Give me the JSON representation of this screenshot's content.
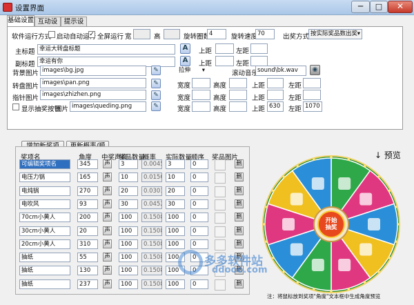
{
  "window": {
    "title": "设置界面",
    "min": "─",
    "max": "□",
    "close": "✕"
  },
  "tabs": [
    "基础设置",
    "互动设置",
    "提示设置"
  ],
  "basic": {
    "run_mode_label": "软件运行方式",
    "autostart_label": "启动自动运行",
    "autostart_checked": false,
    "fullscreen_label": "全屏运行",
    "fullscreen_checked": true,
    "width_label": "宽",
    "height_label": "高",
    "width_value": "",
    "height_value": "",
    "rotation_laps_label": "旋转圈数",
    "rotation_laps_value": "4",
    "rotation_speed_label": "旋转速度",
    "rotation_speed_value": "70",
    "award_mode_label": "出奖方式",
    "award_mode_value": "按实际奖品数出奖",
    "main_title_label": "主标题",
    "main_title_value": "幸运大转盘标题",
    "sub_title_label": "副标题",
    "sub_title_value": "幸运有你",
    "top_label": "上距",
    "left_label": "左距",
    "bg_image_label": "背景图片",
    "bg_image_value": "images\\bg.jpg",
    "stretch_value": "拉伸",
    "music_label": "滚动音乐",
    "music_value": "sound\\bk.wav",
    "wheel_image_label": "转盘图片",
    "wheel_image_value": "images\\pan.png",
    "pointer_image_label": "指针图片",
    "pointer_image_value": "images\\zhizhen.png",
    "show_draw_button_label": "显示抽奖按钮",
    "show_draw_button_checked": false,
    "image_label": "图片",
    "draw_button_image_value": "images\\queding.png",
    "width_short": "宽度",
    "height_short": "高度",
    "draw_button_top_value": "630",
    "draw_button_left_value": "1070"
  },
  "prizes": {
    "add_button": "增加新奖项",
    "update_button": "更新概率/顺序",
    "headers": [
      "奖项名",
      "角度",
      "中奖声音",
      "奖品数量",
      "概率",
      "实际数量",
      "顺序",
      "奖品图片"
    ],
    "sound_btn": "声",
    "delete_btn": "删",
    "rows": [
      {
        "name": "可编辑奖项名",
        "angle": "345",
        "qty": "3",
        "prob": "0.0045",
        "actual": "3",
        "order": "0"
      },
      {
        "name": "电压力锅",
        "angle": "165",
        "qty": "10",
        "prob": "0.0150",
        "actual": "10",
        "order": "0"
      },
      {
        "name": "电炖锅",
        "angle": "270",
        "qty": "20",
        "prob": "0.0301",
        "actual": "20",
        "order": "0"
      },
      {
        "name": "电吹风",
        "angle": "93",
        "qty": "30",
        "prob": "0.0452",
        "actual": "30",
        "order": "0"
      },
      {
        "name": "70cm小黄人",
        "angle": "200",
        "qty": "100",
        "prob": "0.1508",
        "actual": "100",
        "order": "0"
      },
      {
        "name": "30cm小黄人",
        "angle": "20",
        "qty": "100",
        "prob": "0.1508",
        "actual": "100",
        "order": "0"
      },
      {
        "name": "20cm小黄人",
        "angle": "310",
        "qty": "100",
        "prob": "0.1508",
        "actual": "100",
        "order": "0"
      },
      {
        "name": "抽纸",
        "angle": "55",
        "qty": "100",
        "prob": "0.1508",
        "actual": "100",
        "order": "0"
      },
      {
        "name": "抽纸",
        "angle": "130",
        "qty": "100",
        "prob": "0.1508",
        "actual": "100",
        "order": "0"
      },
      {
        "name": "抽纸",
        "angle": "237",
        "qty": "100",
        "prob": "0.1508",
        "actual": "100",
        "order": "0"
      }
    ]
  },
  "preview": {
    "label": "↓ 预览",
    "center_text": "开始抽奖",
    "note": "注：将鼠标放到奖项\"角度\"文本框中生成角度预览"
  },
  "watermark": {
    "line1": "多多软件站",
    "line2": "ddooo.com"
  },
  "colors": {
    "accent_blue": "#2f6fbf",
    "wheel_green": "#2fa84a",
    "wheel_pink": "#e03880",
    "wheel_blue": "#2a8fd8"
  }
}
